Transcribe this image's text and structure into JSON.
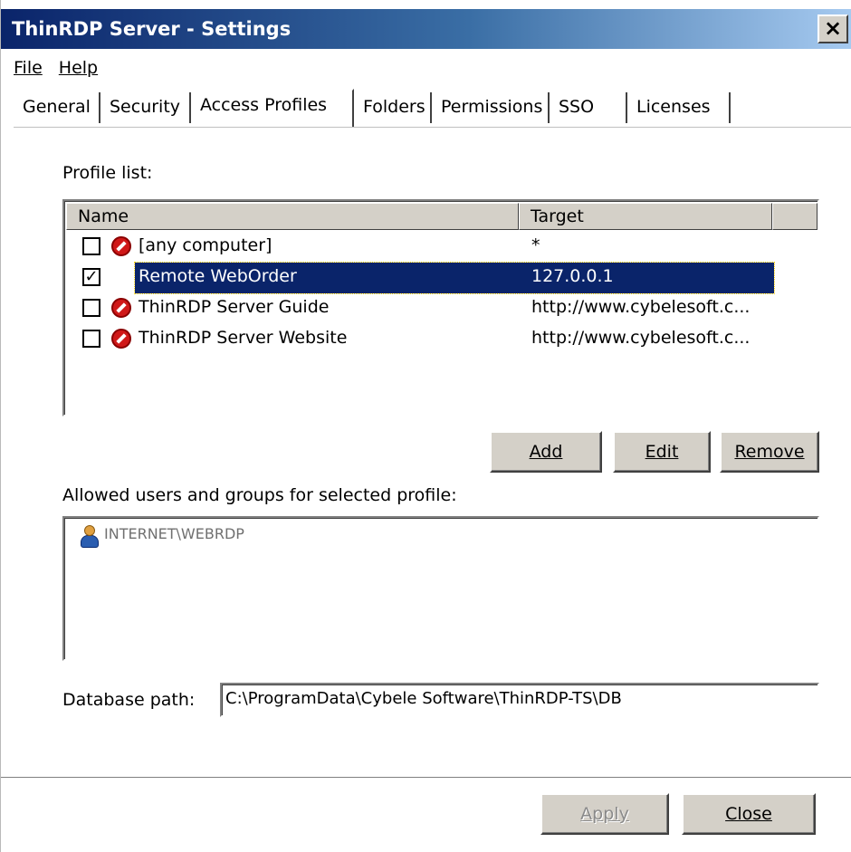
{
  "window": {
    "title": "ThinRDP Server - Settings",
    "close_glyph": "×"
  },
  "menu": [
    {
      "label": "File"
    },
    {
      "label": "Help"
    }
  ],
  "tabs": [
    {
      "label": "General"
    },
    {
      "label": "Security"
    },
    {
      "label": "Access Profiles",
      "active": true
    },
    {
      "label": "Folders"
    },
    {
      "label": "Permissions"
    },
    {
      "label": "SSO"
    },
    {
      "label": "Licenses"
    }
  ],
  "profile_list": {
    "label": "Profile list:",
    "columns": [
      {
        "label": "Name"
      },
      {
        "label": "Target"
      },
      {
        "label": ""
      }
    ],
    "rows": [
      {
        "checked": false,
        "icon": "deny-icon",
        "name": "[any computer]",
        "target": "*"
      },
      {
        "checked": true,
        "icon": "",
        "name": "Remote WebOrder",
        "target": "127.0.0.1",
        "selected": true
      },
      {
        "checked": false,
        "icon": "deny-icon",
        "name": "ThinRDP Server Guide",
        "target": "http://www.cybelesoft.c..."
      },
      {
        "checked": false,
        "icon": "deny-icon",
        "name": "ThinRDP Server Website",
        "target": "http://www.cybelesoft.c..."
      }
    ]
  },
  "buttons": {
    "add": "Add",
    "edit": "Edit",
    "remove": "Remove",
    "apply": "Apply",
    "close": "Close"
  },
  "users": {
    "label": "Allowed users and groups for selected  profile:",
    "items": [
      {
        "icon": "user-icon",
        "name": "INTERNET\\WEBRDP"
      }
    ]
  },
  "database": {
    "label": "Database path:",
    "value": "C:\\ProgramData\\Cybele Software\\ThinRDP-TS\\DB"
  }
}
